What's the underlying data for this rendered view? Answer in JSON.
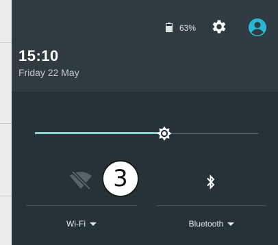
{
  "status": {
    "battery_percent": "63%",
    "battery_level": 0.63
  },
  "header": {
    "time": "15:10",
    "date": "Friday 22 May"
  },
  "brightness": {
    "level": 0.58
  },
  "tiles": [
    {
      "label": "Wi-Fi",
      "icon": "wifi-off-icon",
      "state": "off"
    },
    {
      "label": "Bluetooth",
      "icon": "bluetooth-icon"
    }
  ],
  "callout": {
    "number": "3"
  },
  "colors": {
    "shade_background": "#263238",
    "header_background": "#2f3b41",
    "accent": "#8bd3cf",
    "avatar": "#25b7d3"
  }
}
